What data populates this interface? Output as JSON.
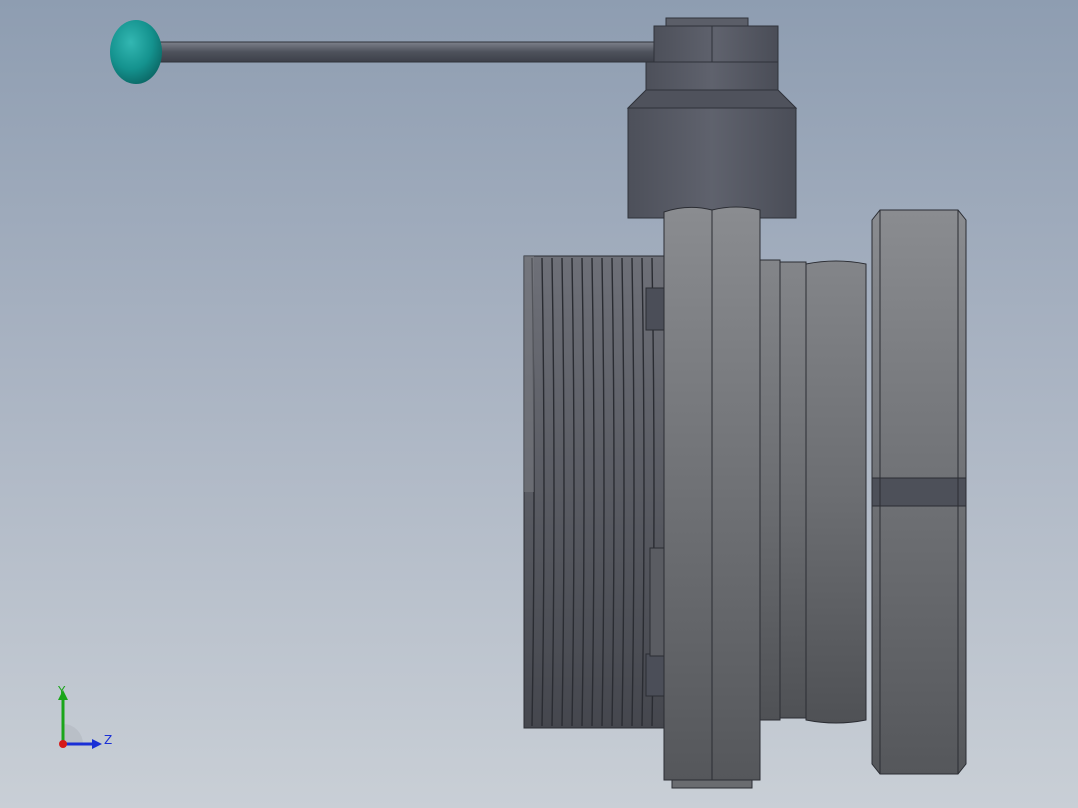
{
  "viewport": {
    "background_top": "#8e9db1",
    "background_bottom": "#c9cfd6"
  },
  "model": {
    "handle_knob_color": "#1a9a96",
    "body_color": "#6f7177",
    "actuator_color": "#5c5f6a"
  },
  "triad": {
    "y_label": "Y",
    "z_label": "Z",
    "y_color": "#1aa51a",
    "z_color": "#1a2fd6",
    "x_color": "#d61a1a"
  }
}
